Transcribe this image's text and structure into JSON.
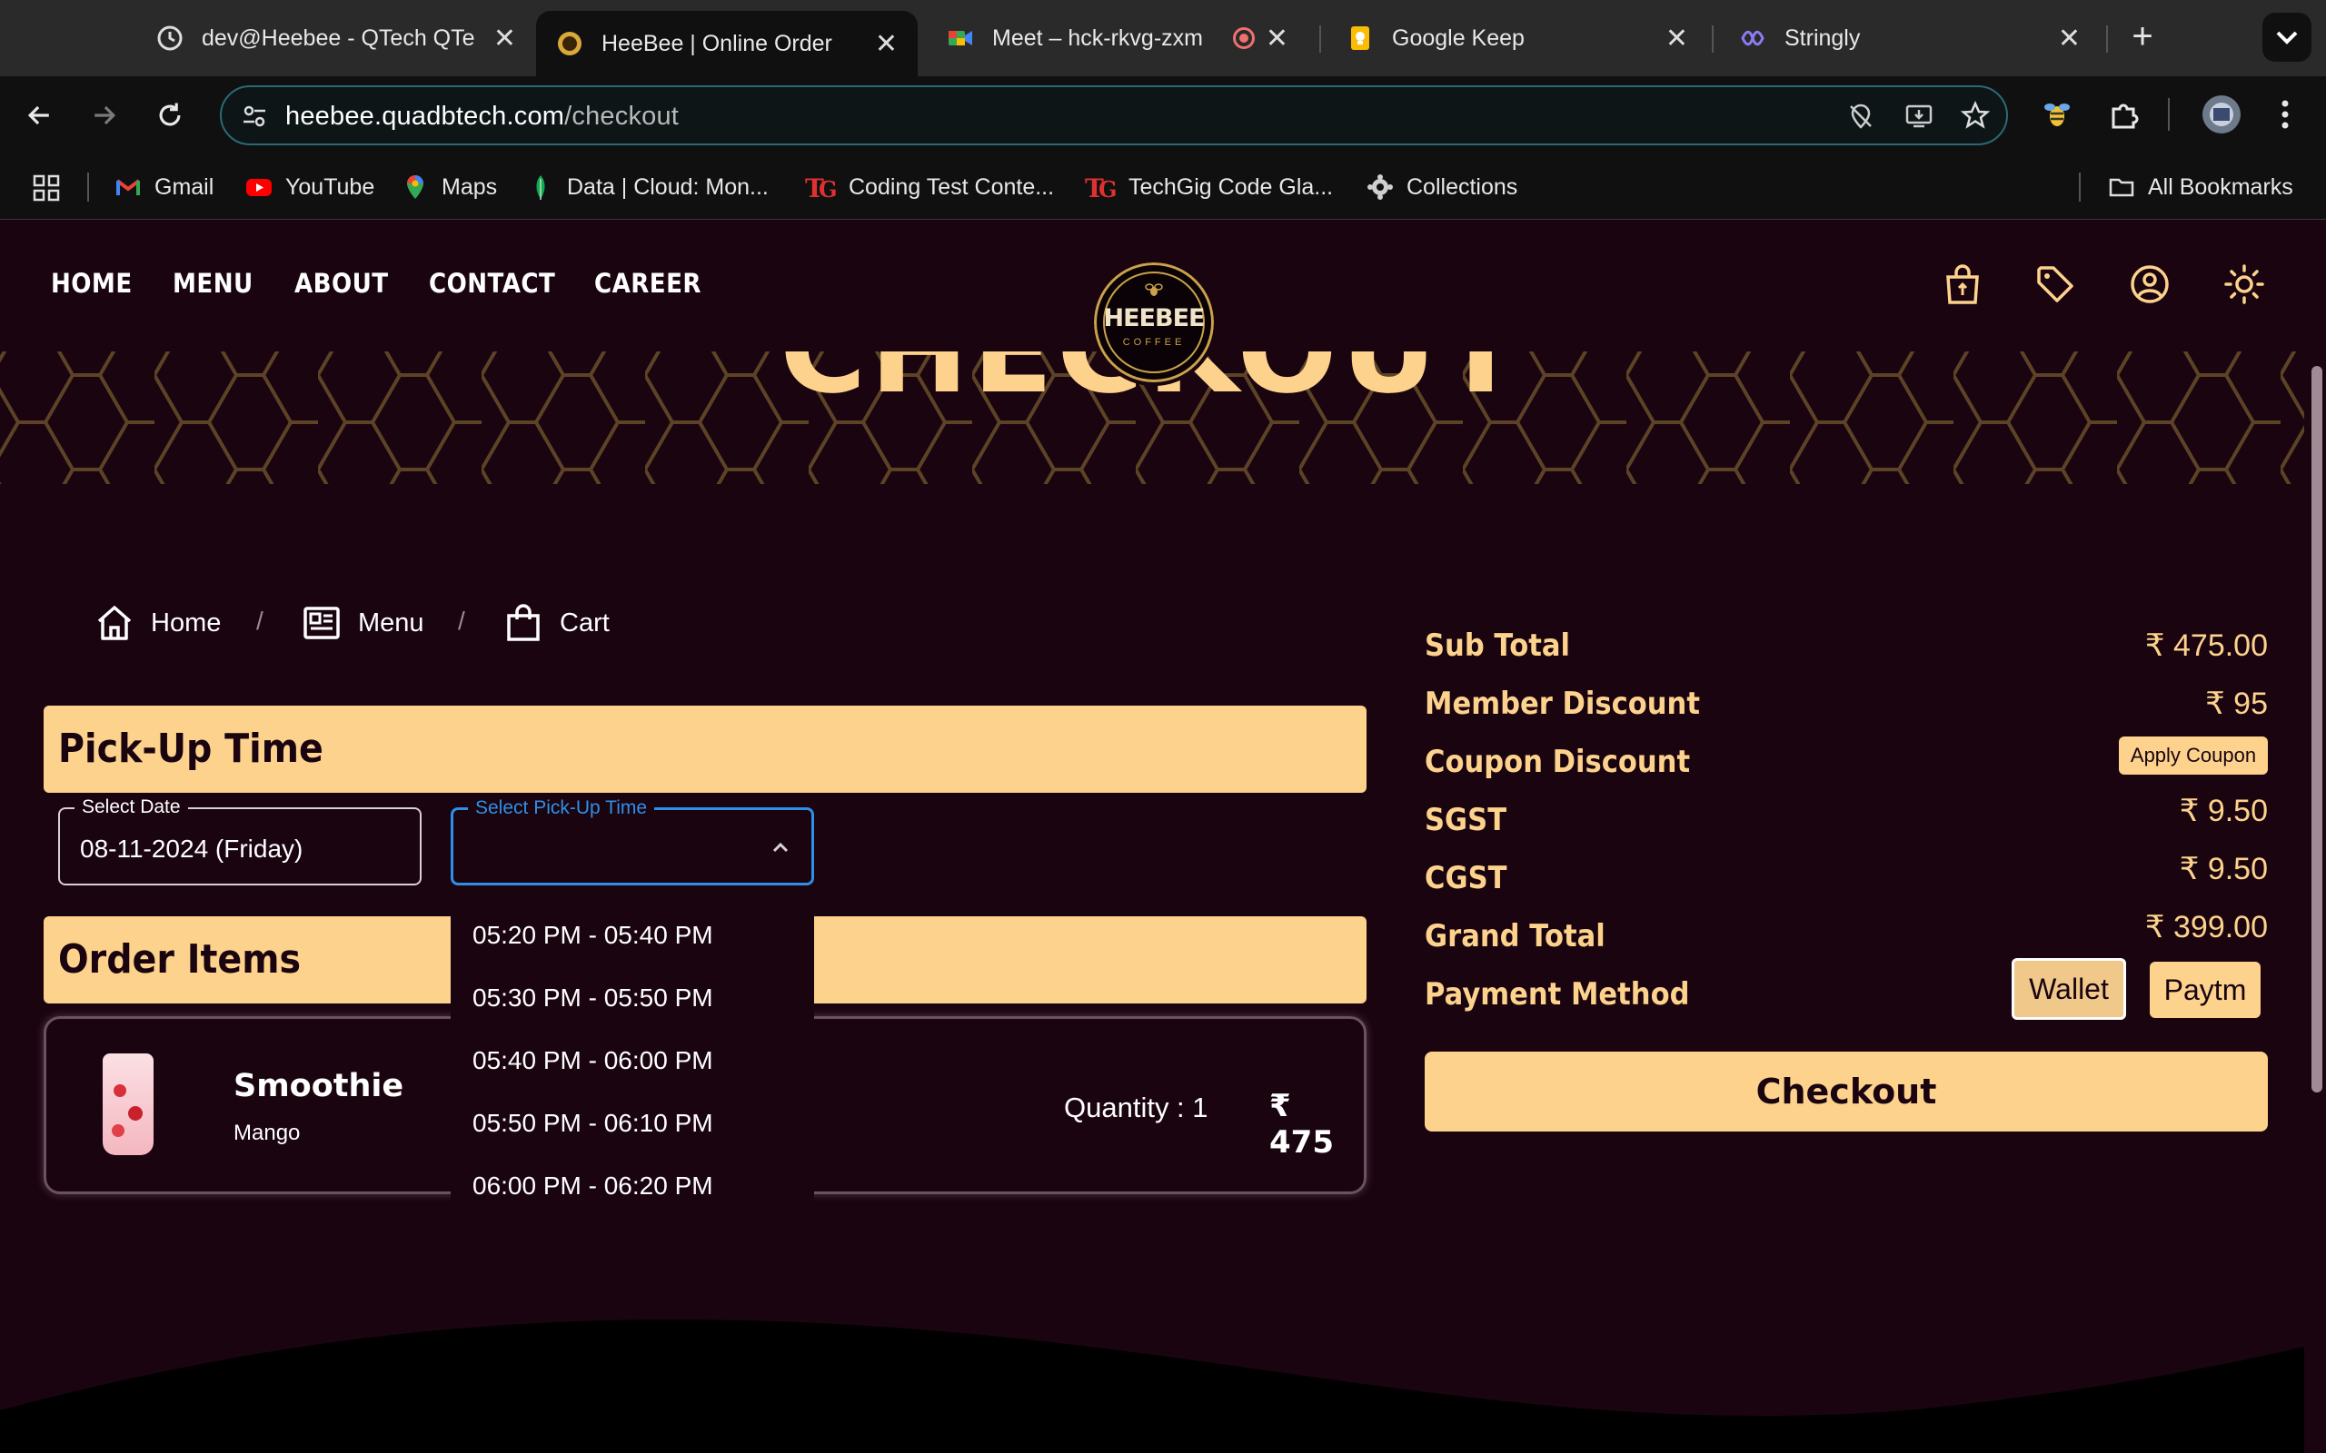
{
  "browser": {
    "tabs": [
      {
        "label": "dev@Heebee - QTech QTe",
        "icon": "dev-clock-icon",
        "active": false
      },
      {
        "label": "HeeBee | Online Order",
        "icon": "heebee-favicon",
        "active": true
      },
      {
        "label": "Meet – hck-rkvg-zxm",
        "icon": "google-meet-icon",
        "active": false
      },
      {
        "label": "Google Keep",
        "icon": "google-keep-icon",
        "active": false
      },
      {
        "label": "Stringly",
        "icon": "stringly-icon",
        "active": false
      }
    ],
    "url_host": "heebee.quadbtech.com",
    "url_path": "/checkout",
    "bookmarks": [
      {
        "label": "Gmail",
        "icon": "gmail-icon"
      },
      {
        "label": "YouTube",
        "icon": "youtube-icon"
      },
      {
        "label": "Maps",
        "icon": "maps-icon"
      },
      {
        "label": "Data | Cloud: Mon...",
        "icon": "mongodb-icon"
      },
      {
        "label": "Coding Test Conte...",
        "icon": "techgig-icon"
      },
      {
        "label": "TechGig Code Gla...",
        "icon": "techgig-icon"
      },
      {
        "label": "Collections",
        "icon": "collections-icon"
      }
    ],
    "all_bookmarks": "All Bookmarks"
  },
  "nav": {
    "links": [
      "HOME",
      "MENU",
      "ABOUT",
      "CONTACT",
      "CAREER"
    ],
    "logo_text": "HEEBEE",
    "logo_sub": "COFFEE"
  },
  "hero": {
    "title": "CHECKOUT"
  },
  "breadcrumb": {
    "home": "Home",
    "menu": "Menu",
    "cart": "Cart",
    "separator": "/"
  },
  "pickup": {
    "title": "Pick-Up Time",
    "date_label": "Select Date",
    "date_value": "08-11-2024 (Friday)",
    "time_label": "Select Pick-Up Time",
    "time_value": "",
    "options": [
      "05:20 PM - 05:40 PM",
      "05:30 PM - 05:50 PM",
      "05:40 PM - 06:00 PM",
      "05:50 PM - 06:10 PM",
      "06:00 PM - 06:20 PM"
    ]
  },
  "order": {
    "title": "Order Items",
    "item": {
      "name": "Smoothie",
      "variant": "Mango",
      "quantity_text": "Quantity : 1",
      "price": "₹ 475"
    }
  },
  "summary": {
    "sub_total_label": "Sub Total",
    "sub_total": "₹ 475.00",
    "member_discount_label": "Member Discount",
    "member_discount": "₹ 95",
    "coupon_label": "Coupon Discount",
    "apply_coupon": "Apply Coupon",
    "sgst_label": "SGST",
    "sgst": "₹ 9.50",
    "cgst_label": "CGST",
    "cgst": "₹ 9.50",
    "grand_total_label": "Grand Total",
    "grand_total": "₹ 399.00",
    "payment_label": "Payment Method",
    "payment_options": [
      "Wallet",
      "Paytm"
    ],
    "checkout": "Checkout"
  },
  "colors": {
    "page_bg": "#1a0410",
    "accent_gold": "#fcd28c",
    "focus_blue": "#2f8fe8",
    "hex_pattern": "#5c4326"
  }
}
